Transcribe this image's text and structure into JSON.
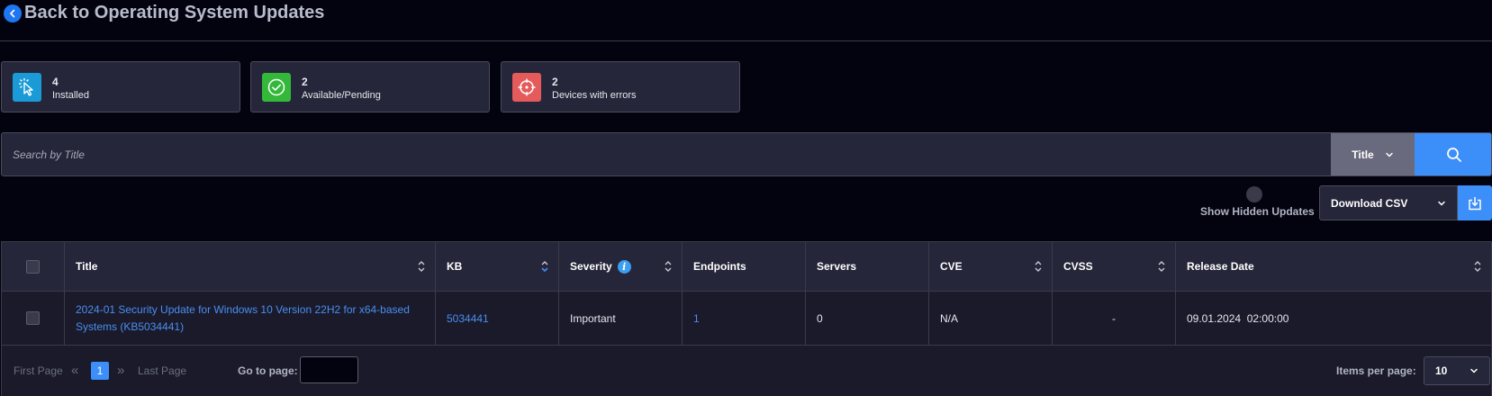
{
  "header": {
    "back_label": "Back to Operating System Updates"
  },
  "stats": [
    {
      "count": "4",
      "label": "Installed",
      "color": "#1a9ad6",
      "icon": "cursor-click-icon"
    },
    {
      "count": "2",
      "label": "Available/Pending",
      "color": "#34b83a",
      "icon": "check-circle-icon"
    },
    {
      "count": "2",
      "label": "Devices with errors",
      "color": "#e55a5a",
      "icon": "crosshair-icon"
    }
  ],
  "search": {
    "placeholder": "Search by Title",
    "field": "Title"
  },
  "toolbar": {
    "hidden_toggle_label": "Show Hidden Updates",
    "download_label": "Download CSV"
  },
  "table": {
    "columns": [
      "Title",
      "KB",
      "Severity",
      "Endpoints",
      "Servers",
      "CVE",
      "CVSS",
      "Release Date"
    ],
    "rows": [
      {
        "title": "2024-01 Security Update for Windows 10 Version 22H2 for x64-based Systems (KB5034441)",
        "kb": "5034441",
        "severity": "Important",
        "endpoints": "1",
        "servers": "0",
        "cve": "N/A",
        "cvss": "-",
        "release_date": "09.01.2024  02:00:00"
      }
    ]
  },
  "pagination": {
    "first_label": "First Page",
    "last_label": "Last Page",
    "current_page": "1",
    "goto_label": "Go to page:",
    "items_label": "Items per page:",
    "items_value": "10"
  },
  "colors": {
    "accent": "#3c8ef8",
    "background": "#03030f",
    "panel": "#26263a"
  }
}
